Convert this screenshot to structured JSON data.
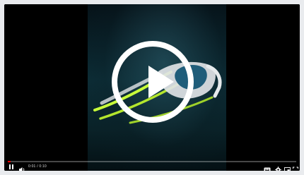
{
  "player": {
    "current_time": "0:01",
    "separator": "/",
    "duration": "0:10",
    "played_fraction": 0.01,
    "accent_color": "#ff0000"
  },
  "icons": {
    "play": "play-icon",
    "pause": "pause-icon",
    "volume": "volume-icon",
    "captions": "captions-icon",
    "settings": "gear-icon",
    "miniplayer": "miniplayer-icon",
    "fullscreen": "fullscreen-icon"
  }
}
